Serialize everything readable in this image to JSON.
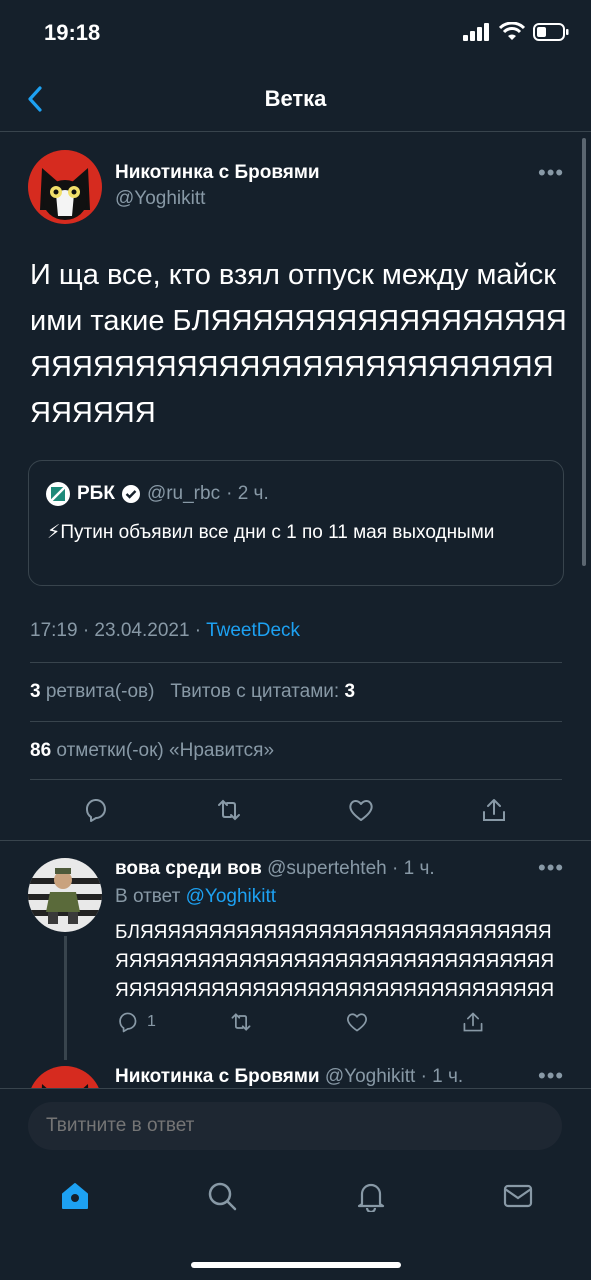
{
  "status_bar": {
    "time": "19:18"
  },
  "nav": {
    "title": "Ветка"
  },
  "main_tweet": {
    "author_name": "Никотинка с Бровями",
    "author_handle": "@Yoghikitt",
    "more": "•••",
    "text": "И ща все, кто взял отпуск между майскими такие БЛЯЯЯЯЯЯЯЯЯЯЯЯЯЯЯЯЯЯЯЯЯЯЯЯЯЯЯЯЯЯЯЯЯЯЯЯЯЯЯЯЯЯЯЯЯЯЯЯ",
    "quote": {
      "name": "РБК",
      "handle": "@ru_rbc",
      "time": "· 2 ч.",
      "text": "⚡Путин объявил все дни с 1 по 11 мая выходными"
    },
    "time_date": "17:19 · 23.04.2021 ·",
    "client": "TweetDeck",
    "retweets_count": "3",
    "retweets_label": "ретвита(-ов)",
    "quotes_label": "Твитов с цитатами:",
    "quotes_count": "3",
    "likes_count": "86",
    "likes_label": "отметки(-ок) «Нравится»"
  },
  "reply_tweet": {
    "author_name": "вова среди вов",
    "author_handle": "@supertehteh",
    "time": "· 1 ч.",
    "more": "•••",
    "reply_prefix": "В ответ",
    "reply_to": "@Yoghikitt",
    "text": "БЛЯЯЯЯЯЯЯЯЯЯЯЯЯЯЯЯЯЯЯЯЯЯЯЯЯЯЯЯЯЯЯЯЯЯЯЯЯЯЯЯЯЯЯЯЯЯЯЯЯЯЯЯЯЯЯЯЯЯЯЯЯЯЯЯЯЯЯЯЯЯЯЯЯЯЯЯЯЯЯЯЯЯЯЯЯЯЯЯЯЯЯЯЯЯ",
    "reply_count": "1"
  },
  "next_tweet": {
    "author_name": "Никотинка с Бровями",
    "author_handle": "@Yoghikitt",
    "time": "· 1 ч.",
    "more": "•••"
  },
  "composer": {
    "placeholder": "Твитните в ответ"
  },
  "colors": {
    "background": "#15202b",
    "accent": "#1da1f2",
    "secondary_text": "#8899a6",
    "divider": "#38444d"
  }
}
